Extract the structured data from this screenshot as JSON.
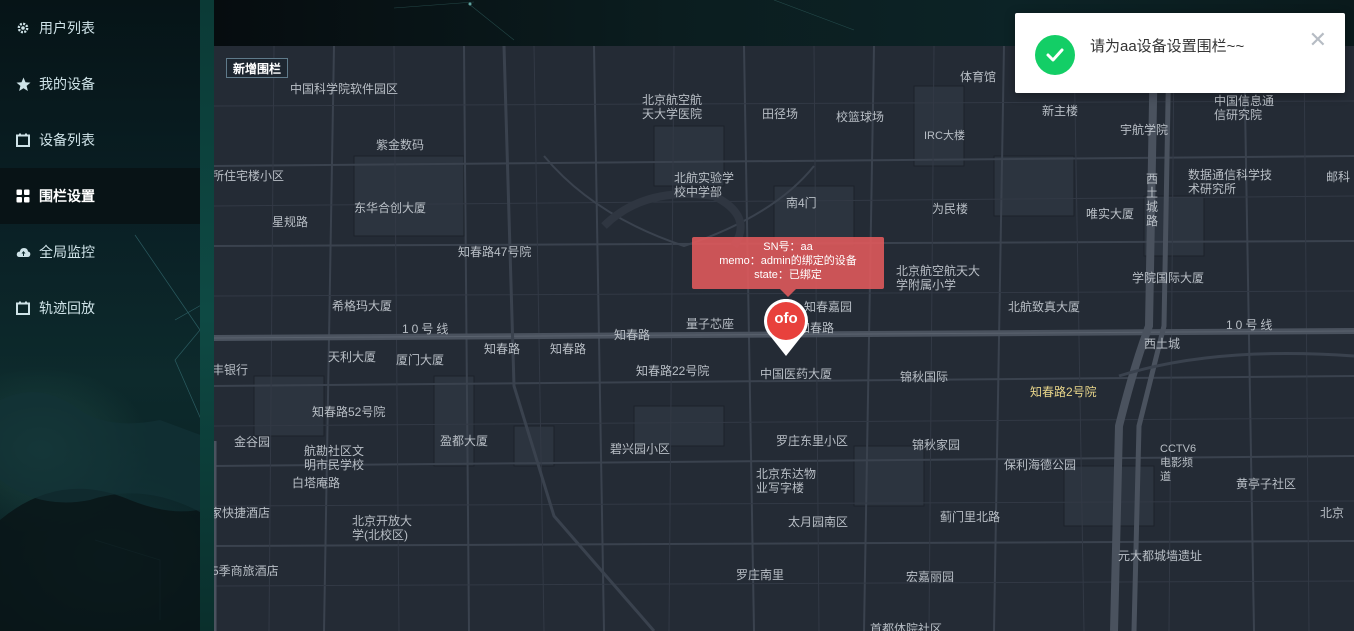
{
  "sidebar": {
    "items": [
      {
        "label": "用户列表",
        "icon": "gear-icon",
        "active": false
      },
      {
        "label": "我的设备",
        "icon": "star-icon",
        "active": false
      },
      {
        "label": "设备列表",
        "icon": "calendar-icon",
        "active": false
      },
      {
        "label": "围栏设置",
        "icon": "grid-icon",
        "active": true
      },
      {
        "label": "全局监控",
        "icon": "cloud-upload-icon",
        "active": false
      },
      {
        "label": "轨迹回放",
        "icon": "calendar-icon",
        "active": false
      }
    ]
  },
  "map": {
    "add_fence_label": "新增围栏",
    "popup": {
      "sn": "SN号：aa",
      "memo": "memo：admin的绑定的设备",
      "state": "state：已绑定"
    },
    "marker_label": "ofo",
    "labels": [
      "中国科学院软件园区",
      "紫金数码",
      "东华合创大厦",
      "星规路",
      "知春路47号院",
      "希格玛大厦",
      "天利大厦",
      "厦门大厦",
      "知春路",
      "知春路",
      "知春路",
      "知春路52号院",
      "金谷园",
      "航勘社区文明市民学校",
      "白塔庵路",
      "盈都大厦",
      "北京开放大学(北校区)",
      "北京航空航天大学医院",
      "田径场",
      "校篮球场",
      "体育馆",
      "北航实验学校中学部",
      "南4门",
      "为民楼",
      "IRC大楼",
      "新主楼",
      "宇航学院",
      "唯实大厦",
      "北京航空航天大学附属小学",
      "学院国际大厦",
      "北航致真大厦",
      "知春嘉园",
      "知春路",
      "量子芯座",
      "中国医药大厦",
      "知春路22号院",
      "锦秋国际",
      "罗庄东里小区",
      "锦秋家园",
      "碧兴园小区",
      "北京东达物业写字楼",
      "太月园南区",
      "罗庄南里",
      "宏嘉丽园",
      "蓟门里北路",
      "保利海德公园",
      "知春路2号院",
      "西土城",
      "元大都城墙遗址",
      "黄亭子社区",
      "中国信息通信研究院",
      "数据通信科学技术研究所",
      "邮科",
      "西土城路",
      "10号线",
      "10号线",
      "北京",
      "家快捷酒店",
      "5季商旅酒店",
      "丰银行",
      "所住宅楼小区",
      "CCTV6电影频道",
      "首都体院社区"
    ]
  },
  "notification": {
    "message": "请为aa设备设置围栏~~",
    "status_icon": "success-check-icon",
    "close_icon": "close-icon",
    "color": "#13ce66"
  }
}
